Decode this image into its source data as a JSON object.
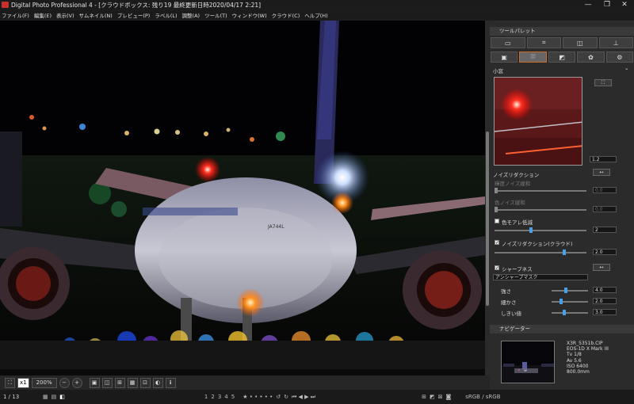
{
  "window": {
    "title": "Digital Photo Professional 4 - [クラウドボックス: 残り19 最終更新日時2020/04/17 2:21]",
    "min": "—",
    "restore": "❐",
    "close": "✕"
  },
  "menu": [
    "ファイル(F)",
    "編集(E)",
    "表示(V)",
    "サムネイル(N)",
    "プレビュー(P)",
    "ラベル(L)",
    "調整(A)",
    "ツール(T)",
    "ウィンドウ(W)",
    "クラウド(C)",
    "ヘルプ(H)"
  ],
  "toolbar": {
    "fit": "⛶",
    "x1": "x1",
    "zoom": "200%",
    "zoom_minus": "−",
    "zoom_plus": "+"
  },
  "status": {
    "count": "1 / 13",
    "ratings": [
      "1",
      "2",
      "3",
      "4",
      "5"
    ],
    "colorspace": "sRGB / sRGB"
  },
  "panel": {
    "tool_palette": "ツールパレット",
    "section_title": "小窓",
    "zoom_value": "1.2",
    "noise_reduction": "ノイズリダクション",
    "luma_nr": "輝度ノイズ緩和",
    "luma_val": "0.0",
    "chroma_nr": "色ノイズ緩和",
    "chroma_val": "0.0",
    "moire": "色モアレ低減",
    "moire_val": "2",
    "cloud_nr": "ノイズリダクション(クラウド)",
    "cloud_nr_val": "2.0",
    "sharpness": "シャープネス",
    "sharp_mode": "アンシャープマスク",
    "strength": "強さ",
    "strength_val": "4.0",
    "fineness": "細かさ",
    "fineness_val": "2.0",
    "threshold": "しきい値",
    "threshold_val": "3.0",
    "navigator": "ナビゲーター"
  },
  "photo_info": {
    "file": "X3R_5351b.CIP",
    "camera": "EOS-1D X Mark III",
    "tv": "Tv 1/8",
    "av": "Av 5.6",
    "iso": "ISO 6400",
    "focal": "800.0mm"
  },
  "aircraft_marking": "JA744L",
  "colors": {
    "accent": "#4aa0e6",
    "tab_active": "#c86a2a"
  }
}
